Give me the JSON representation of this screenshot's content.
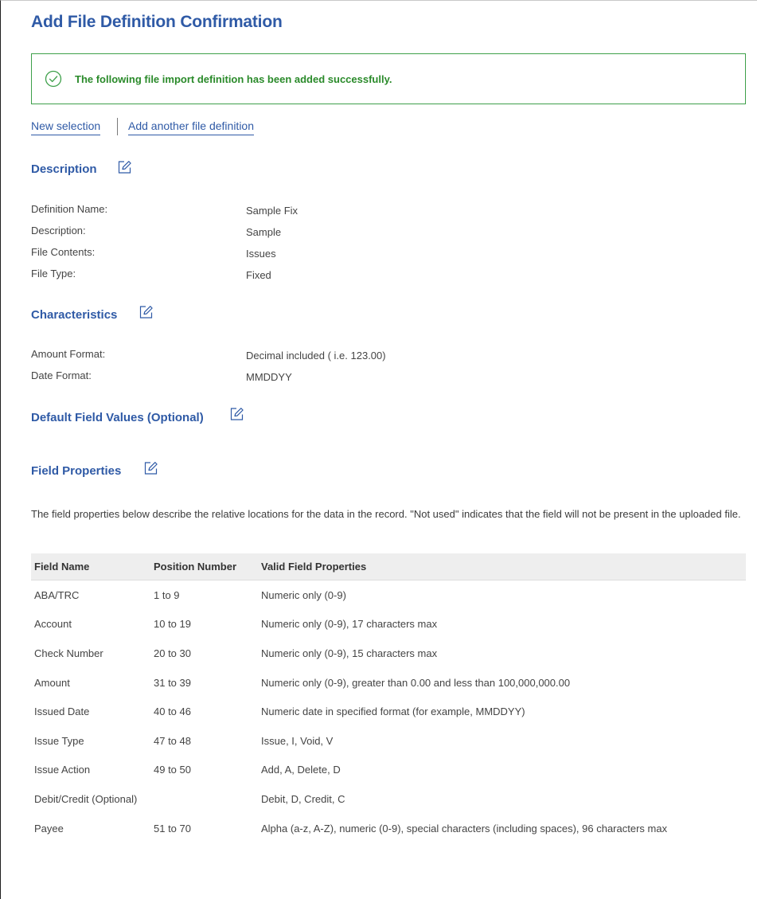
{
  "page": {
    "title": "Add File Definition Confirmation"
  },
  "alert": {
    "message": "The following file import definition has been added successfully.",
    "icon": "check-circle-icon"
  },
  "links": {
    "new_selection": "New selection",
    "add_another": "Add another file definition"
  },
  "description": {
    "heading": "Description",
    "rows": [
      {
        "label": "Definition Name:",
        "value": "Sample Fix"
      },
      {
        "label": "Description:",
        "value": "Sample"
      },
      {
        "label": "File Contents:",
        "value": "Issues"
      },
      {
        "label": "File Type:",
        "value": "Fixed"
      }
    ]
  },
  "characteristics": {
    "heading": "Characteristics",
    "rows": [
      {
        "label": "Amount Format:",
        "value": "Decimal included ( i.e. 123.00)"
      },
      {
        "label": "Date Format:",
        "value": "MMDDYY"
      }
    ]
  },
  "default_values": {
    "heading": "Default Field Values (Optional)"
  },
  "field_properties": {
    "heading": "Field Properties",
    "intro": "The field properties below describe the relative locations for the data in the record. \"Not used\" indicates that the field will not be present in the uploaded file.",
    "columns": [
      "Field Name",
      "Position Number",
      "Valid Field Properties"
    ],
    "rows": [
      [
        "ABA/TRC",
        "1 to 9",
        "Numeric only (0-9)"
      ],
      [
        "Account",
        "10 to 19",
        "Numeric only (0-9), 17 characters max"
      ],
      [
        "Check Number",
        "20 to 30",
        "Numeric only (0-9), 15 characters max"
      ],
      [
        "Amount",
        "31 to 39",
        "Numeric only (0-9), greater than 0.00 and less than 100,000,000.00"
      ],
      [
        "Issued Date",
        "40 to 46",
        "Numeric date in specified format (for example, MMDDYY)"
      ],
      [
        "Issue Type",
        "47 to 48",
        "Issue, I, Void, V"
      ],
      [
        "Issue Action",
        "49 to 50",
        "Add, A, Delete, D"
      ],
      [
        "Debit/Credit (Optional)",
        "",
        "Debit, D, Credit, C"
      ],
      [
        "Payee",
        "51 to 70",
        "Alpha (a-z, A-Z), numeric (0-9), special characters (including spaces), 96 characters max"
      ]
    ]
  },
  "colors": {
    "accent": "#2f5aa6",
    "success": "#3ea04a",
    "success_text": "#2a8a2a",
    "header_bg": "#eeeeee"
  }
}
